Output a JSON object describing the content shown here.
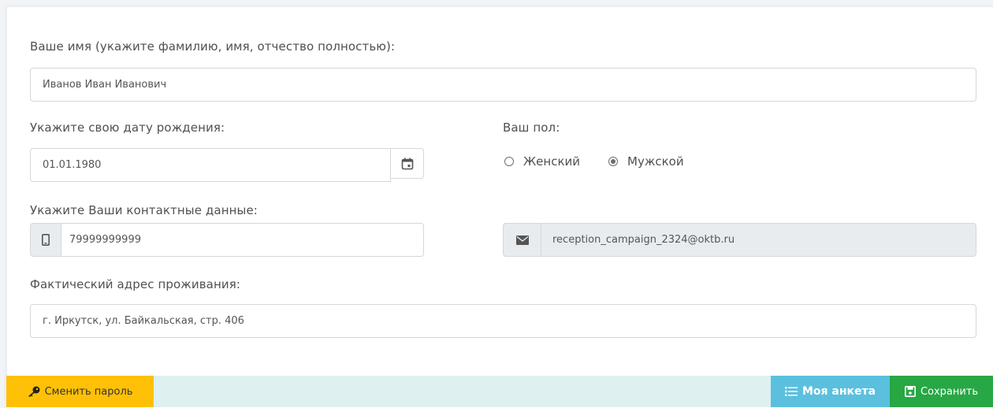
{
  "form": {
    "name_label": "Ваше имя (укажите фамилию, имя, отчество полностью):",
    "name_value": "Иванов Иван Иванович",
    "birthdate_label": "Укажите свою дату рождения:",
    "birthdate_value": "01.01.1980",
    "gender_label": "Ваш пол:",
    "gender_options": [
      {
        "label": "Женский",
        "selected": false
      },
      {
        "label": "Мужской",
        "selected": true
      }
    ],
    "contacts_label": "Укажите Ваши контактные данные:",
    "phone_value": "79999999999",
    "email_value": "reception_campaign_2324@oktb.ru",
    "address_label": "Фактический адрес проживания:",
    "address_value": "г. Иркутск, ул. Байкальская, стр. 406"
  },
  "footer": {
    "change_password_label": "Сменить пароль",
    "my_form_label": "Моя анкета",
    "save_label": "Сохранить"
  },
  "colors": {
    "change_password_bg": "#ffc107",
    "my_form_bg": "#5bc0de",
    "save_bg": "#28a745",
    "footer_bg": "#dff0f1",
    "readonly_bg": "#e9ecef"
  },
  "icons": {
    "calendar": "calendar-icon",
    "phone": "mobile-phone-icon",
    "email": "envelope-icon",
    "key": "key-icon",
    "list": "list-icon",
    "save": "floppy-disk-icon"
  }
}
